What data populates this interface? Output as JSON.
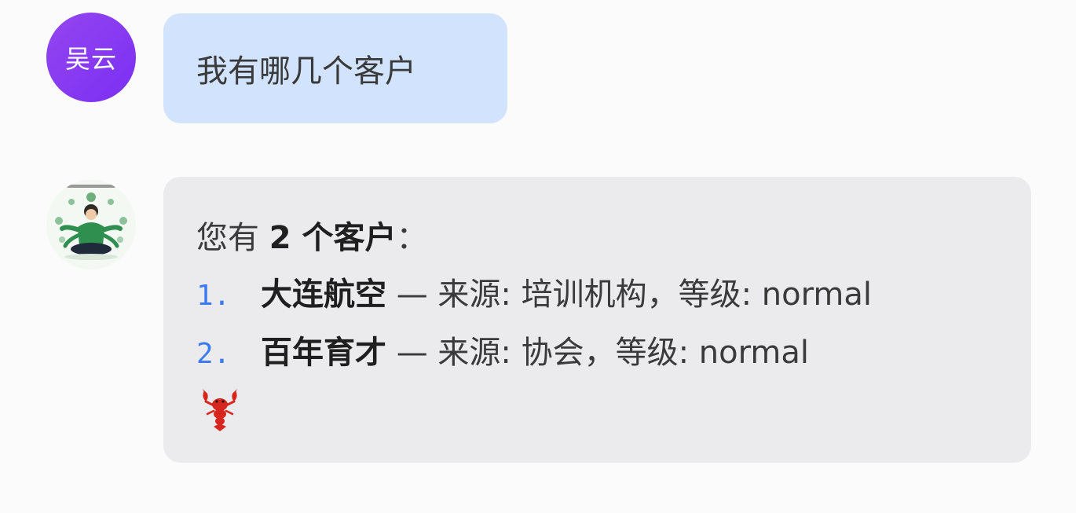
{
  "user_message": {
    "avatar_text": "吴云",
    "text": "我有哪几个客户"
  },
  "bot_message": {
    "intro_prefix": "您有 ",
    "intro_count": "2 个客户",
    "intro_suffix": "：",
    "items": [
      {
        "number": "1.",
        "name": "大连航空",
        "details": " — 来源: 培训机构，等级: normal"
      },
      {
        "number": "2.",
        "name": "百年育才",
        "details": " — 来源: 协会，等级: normal"
      }
    ],
    "emoji_icon": "lobster-icon"
  },
  "colors": {
    "user_bubble": "#d2e3fe",
    "bot_bubble": "#ebebee",
    "avatar_gradient_start": "#9446f0",
    "list_number": "#3d7bf0"
  }
}
